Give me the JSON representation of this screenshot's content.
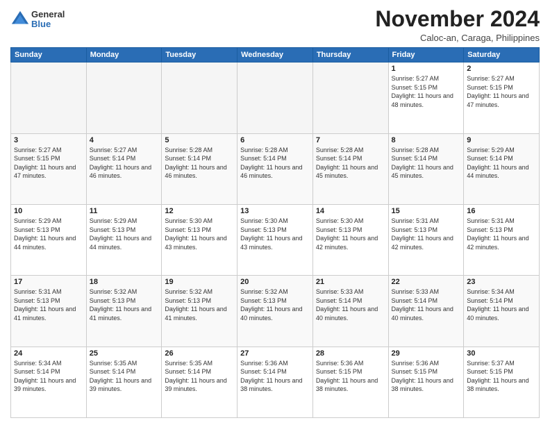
{
  "logo": {
    "general": "General",
    "blue": "Blue"
  },
  "title": "November 2024",
  "location": "Caloc-an, Caraga, Philippines",
  "weekdays": [
    "Sunday",
    "Monday",
    "Tuesday",
    "Wednesday",
    "Thursday",
    "Friday",
    "Saturday"
  ],
  "weeks": [
    [
      {
        "day": "",
        "sunrise": "",
        "sunset": "",
        "daylight": "",
        "empty": true
      },
      {
        "day": "",
        "sunrise": "",
        "sunset": "",
        "daylight": "",
        "empty": true
      },
      {
        "day": "",
        "sunrise": "",
        "sunset": "",
        "daylight": "",
        "empty": true
      },
      {
        "day": "",
        "sunrise": "",
        "sunset": "",
        "daylight": "",
        "empty": true
      },
      {
        "day": "",
        "sunrise": "",
        "sunset": "",
        "daylight": "",
        "empty": true
      },
      {
        "day": "1",
        "sunrise": "Sunrise: 5:27 AM",
        "sunset": "Sunset: 5:15 PM",
        "daylight": "Daylight: 11 hours and 48 minutes.",
        "empty": false
      },
      {
        "day": "2",
        "sunrise": "Sunrise: 5:27 AM",
        "sunset": "Sunset: 5:15 PM",
        "daylight": "Daylight: 11 hours and 47 minutes.",
        "empty": false
      }
    ],
    [
      {
        "day": "3",
        "sunrise": "Sunrise: 5:27 AM",
        "sunset": "Sunset: 5:15 PM",
        "daylight": "Daylight: 11 hours and 47 minutes.",
        "empty": false
      },
      {
        "day": "4",
        "sunrise": "Sunrise: 5:27 AM",
        "sunset": "Sunset: 5:14 PM",
        "daylight": "Daylight: 11 hours and 46 minutes.",
        "empty": false
      },
      {
        "day": "5",
        "sunrise": "Sunrise: 5:28 AM",
        "sunset": "Sunset: 5:14 PM",
        "daylight": "Daylight: 11 hours and 46 minutes.",
        "empty": false
      },
      {
        "day": "6",
        "sunrise": "Sunrise: 5:28 AM",
        "sunset": "Sunset: 5:14 PM",
        "daylight": "Daylight: 11 hours and 46 minutes.",
        "empty": false
      },
      {
        "day": "7",
        "sunrise": "Sunrise: 5:28 AM",
        "sunset": "Sunset: 5:14 PM",
        "daylight": "Daylight: 11 hours and 45 minutes.",
        "empty": false
      },
      {
        "day": "8",
        "sunrise": "Sunrise: 5:28 AM",
        "sunset": "Sunset: 5:14 PM",
        "daylight": "Daylight: 11 hours and 45 minutes.",
        "empty": false
      },
      {
        "day": "9",
        "sunrise": "Sunrise: 5:29 AM",
        "sunset": "Sunset: 5:14 PM",
        "daylight": "Daylight: 11 hours and 44 minutes.",
        "empty": false
      }
    ],
    [
      {
        "day": "10",
        "sunrise": "Sunrise: 5:29 AM",
        "sunset": "Sunset: 5:13 PM",
        "daylight": "Daylight: 11 hours and 44 minutes.",
        "empty": false
      },
      {
        "day": "11",
        "sunrise": "Sunrise: 5:29 AM",
        "sunset": "Sunset: 5:13 PM",
        "daylight": "Daylight: 11 hours and 44 minutes.",
        "empty": false
      },
      {
        "day": "12",
        "sunrise": "Sunrise: 5:30 AM",
        "sunset": "Sunset: 5:13 PM",
        "daylight": "Daylight: 11 hours and 43 minutes.",
        "empty": false
      },
      {
        "day": "13",
        "sunrise": "Sunrise: 5:30 AM",
        "sunset": "Sunset: 5:13 PM",
        "daylight": "Daylight: 11 hours and 43 minutes.",
        "empty": false
      },
      {
        "day": "14",
        "sunrise": "Sunrise: 5:30 AM",
        "sunset": "Sunset: 5:13 PM",
        "daylight": "Daylight: 11 hours and 42 minutes.",
        "empty": false
      },
      {
        "day": "15",
        "sunrise": "Sunrise: 5:31 AM",
        "sunset": "Sunset: 5:13 PM",
        "daylight": "Daylight: 11 hours and 42 minutes.",
        "empty": false
      },
      {
        "day": "16",
        "sunrise": "Sunrise: 5:31 AM",
        "sunset": "Sunset: 5:13 PM",
        "daylight": "Daylight: 11 hours and 42 minutes.",
        "empty": false
      }
    ],
    [
      {
        "day": "17",
        "sunrise": "Sunrise: 5:31 AM",
        "sunset": "Sunset: 5:13 PM",
        "daylight": "Daylight: 11 hours and 41 minutes.",
        "empty": false
      },
      {
        "day": "18",
        "sunrise": "Sunrise: 5:32 AM",
        "sunset": "Sunset: 5:13 PM",
        "daylight": "Daylight: 11 hours and 41 minutes.",
        "empty": false
      },
      {
        "day": "19",
        "sunrise": "Sunrise: 5:32 AM",
        "sunset": "Sunset: 5:13 PM",
        "daylight": "Daylight: 11 hours and 41 minutes.",
        "empty": false
      },
      {
        "day": "20",
        "sunrise": "Sunrise: 5:32 AM",
        "sunset": "Sunset: 5:13 PM",
        "daylight": "Daylight: 11 hours and 40 minutes.",
        "empty": false
      },
      {
        "day": "21",
        "sunrise": "Sunrise: 5:33 AM",
        "sunset": "Sunset: 5:14 PM",
        "daylight": "Daylight: 11 hours and 40 minutes.",
        "empty": false
      },
      {
        "day": "22",
        "sunrise": "Sunrise: 5:33 AM",
        "sunset": "Sunset: 5:14 PM",
        "daylight": "Daylight: 11 hours and 40 minutes.",
        "empty": false
      },
      {
        "day": "23",
        "sunrise": "Sunrise: 5:34 AM",
        "sunset": "Sunset: 5:14 PM",
        "daylight": "Daylight: 11 hours and 40 minutes.",
        "empty": false
      }
    ],
    [
      {
        "day": "24",
        "sunrise": "Sunrise: 5:34 AM",
        "sunset": "Sunset: 5:14 PM",
        "daylight": "Daylight: 11 hours and 39 minutes.",
        "empty": false
      },
      {
        "day": "25",
        "sunrise": "Sunrise: 5:35 AM",
        "sunset": "Sunset: 5:14 PM",
        "daylight": "Daylight: 11 hours and 39 minutes.",
        "empty": false
      },
      {
        "day": "26",
        "sunrise": "Sunrise: 5:35 AM",
        "sunset": "Sunset: 5:14 PM",
        "daylight": "Daylight: 11 hours and 39 minutes.",
        "empty": false
      },
      {
        "day": "27",
        "sunrise": "Sunrise: 5:36 AM",
        "sunset": "Sunset: 5:14 PM",
        "daylight": "Daylight: 11 hours and 38 minutes.",
        "empty": false
      },
      {
        "day": "28",
        "sunrise": "Sunrise: 5:36 AM",
        "sunset": "Sunset: 5:15 PM",
        "daylight": "Daylight: 11 hours and 38 minutes.",
        "empty": false
      },
      {
        "day": "29",
        "sunrise": "Sunrise: 5:36 AM",
        "sunset": "Sunset: 5:15 PM",
        "daylight": "Daylight: 11 hours and 38 minutes.",
        "empty": false
      },
      {
        "day": "30",
        "sunrise": "Sunrise: 5:37 AM",
        "sunset": "Sunset: 5:15 PM",
        "daylight": "Daylight: 11 hours and 38 minutes.",
        "empty": false
      }
    ]
  ]
}
